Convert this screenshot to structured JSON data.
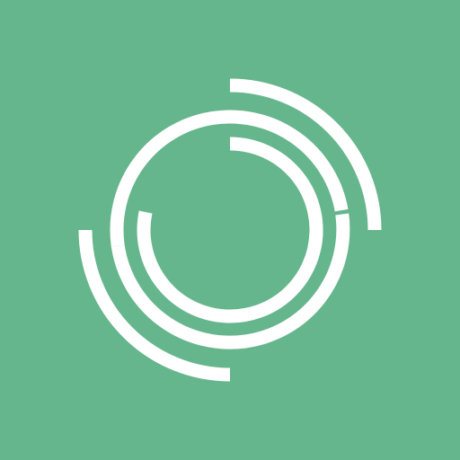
{
  "icon": {
    "name": "swirl-logo-icon",
    "background_color": "#66b68d",
    "stroke_color": "#ffffff"
  }
}
